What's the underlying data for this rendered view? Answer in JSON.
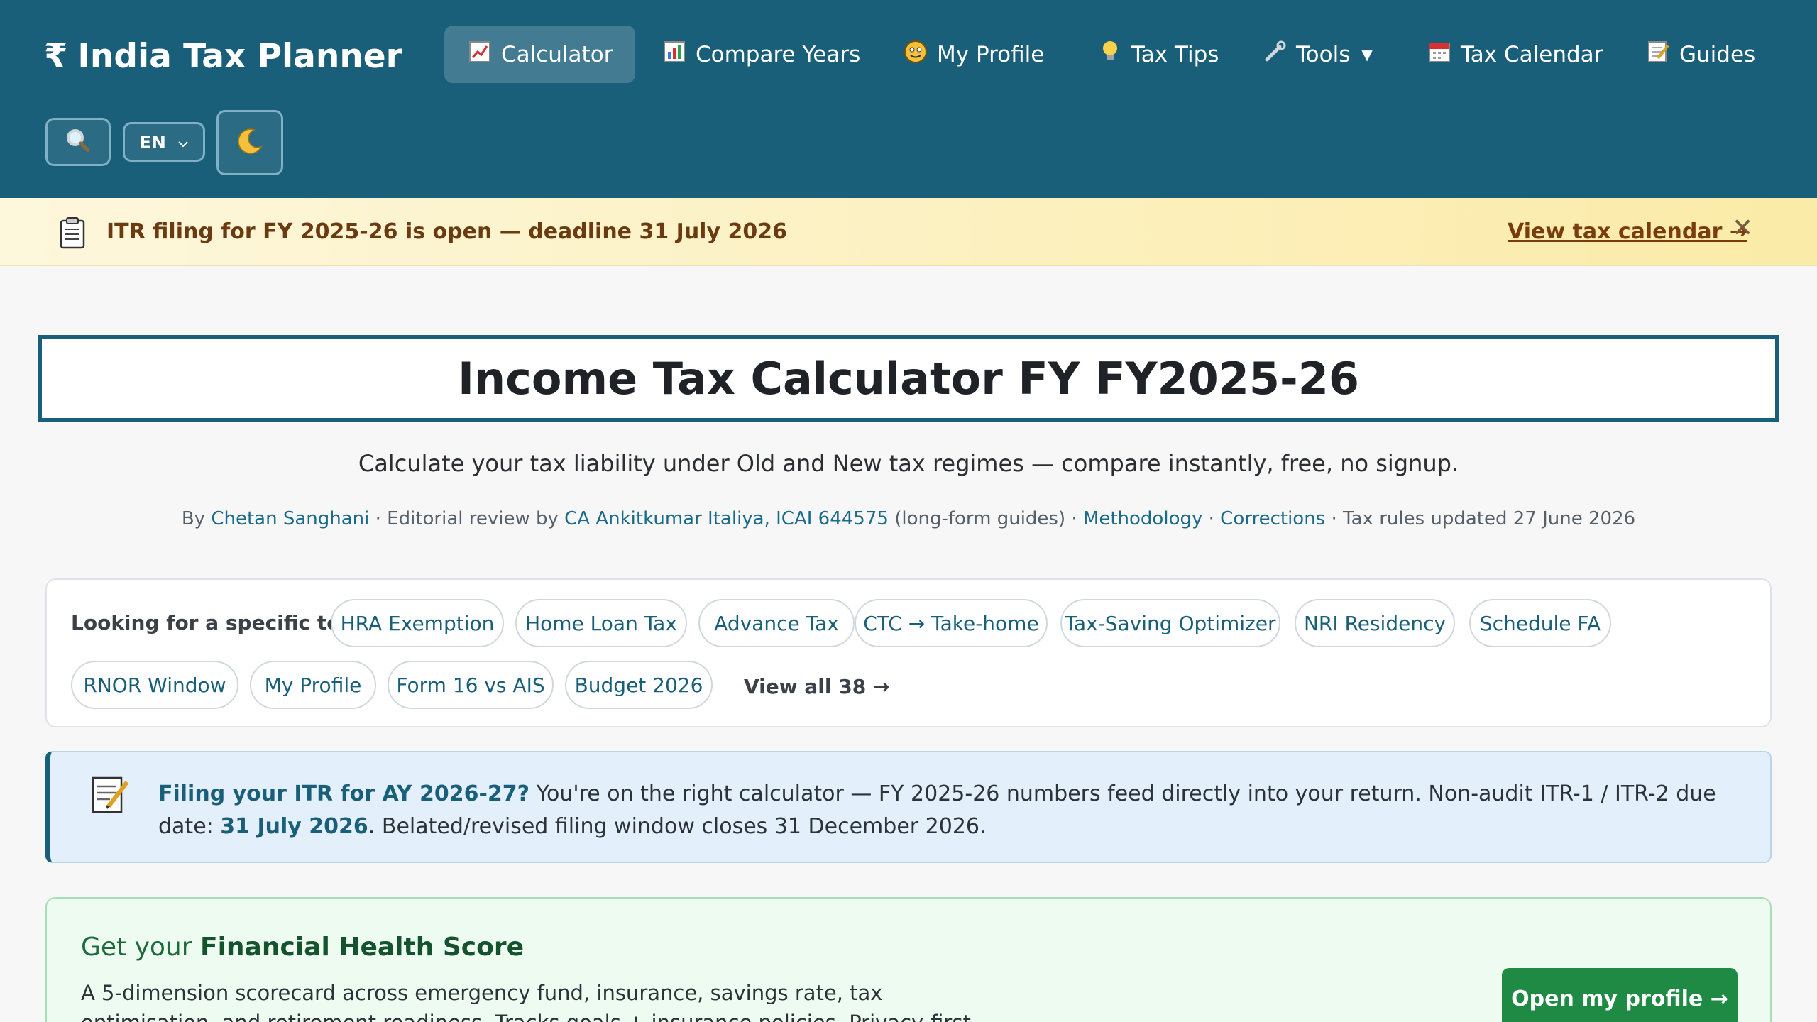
{
  "brand": {
    "symbol": "₹",
    "name": "India Tax Planner"
  },
  "nav": [
    {
      "label": "Calculator",
      "icon": "chart-up-icon"
    },
    {
      "label": "Compare Years",
      "icon": "bar-chart-icon"
    },
    {
      "label": "My Profile",
      "icon": "face-icon"
    },
    {
      "label": "Tax Tips",
      "icon": "lightbulb-icon"
    },
    {
      "label": "Tools",
      "icon": "wrench-icon"
    },
    {
      "label": "Tax Calendar",
      "icon": "calendar-icon"
    },
    {
      "label": "Guides",
      "icon": "memo-icon"
    }
  ],
  "header_controls": {
    "language": "EN",
    "search_icon": "magnifier-icon",
    "theme_icon": "moon-icon"
  },
  "banner": {
    "text": "ITR filing for FY 2025-26 is open — deadline 31 July 2026",
    "link": "View tax calendar →",
    "close": "✕"
  },
  "page": {
    "title": "Income Tax Calculator FY FY2025-26",
    "subtitle": "Calculate your tax liability under Old and New tax regimes — compare instantly, free, no signup."
  },
  "byline": {
    "by": "By ",
    "author": "Chetan Sanghani",
    "review_prefix": " · Editorial review by ",
    "reviewer": "CA Ankitkumar Italiya, ICAI 644575",
    "review_suffix": " (long-form guides) · ",
    "methodology": "Methodology",
    "sep": " · ",
    "corrections": "Corrections",
    "updated": " · Tax rules updated 27 June 2026"
  },
  "tools": {
    "label": "Looking for a specific tool?",
    "chips": [
      "HRA Exemption",
      "Home Loan Tax",
      "Advance Tax",
      "CTC → Take-home",
      "Tax-Saving Optimizer",
      "NRI Residency",
      "Schedule FA",
      "RNOR Window",
      "My Profile",
      "Form 16 vs AIS",
      "Budget 2026"
    ],
    "view_all": "View all 38 →"
  },
  "itr_notice": {
    "heading": "Filing your ITR for AY 2026-27?",
    "body": " You're on the right calculator — FY 2025-26 numbers feed directly into your return. Non-audit ITR-1 / ITR-2 due date: ",
    "due_date": "31 July 2026",
    "tail": ". Belated/revised filing window closes 31 December 2026."
  },
  "health": {
    "title_prefix": "Get your ",
    "title_bold": "Financial Health Score",
    "desc": "A 5-dimension scorecard across emergency fund, insurance, savings rate, tax optimisation, and retirement readiness. Tracks goals + insurance policies. Privacy-first — every input stays in your",
    "button": "Open my profile →"
  }
}
